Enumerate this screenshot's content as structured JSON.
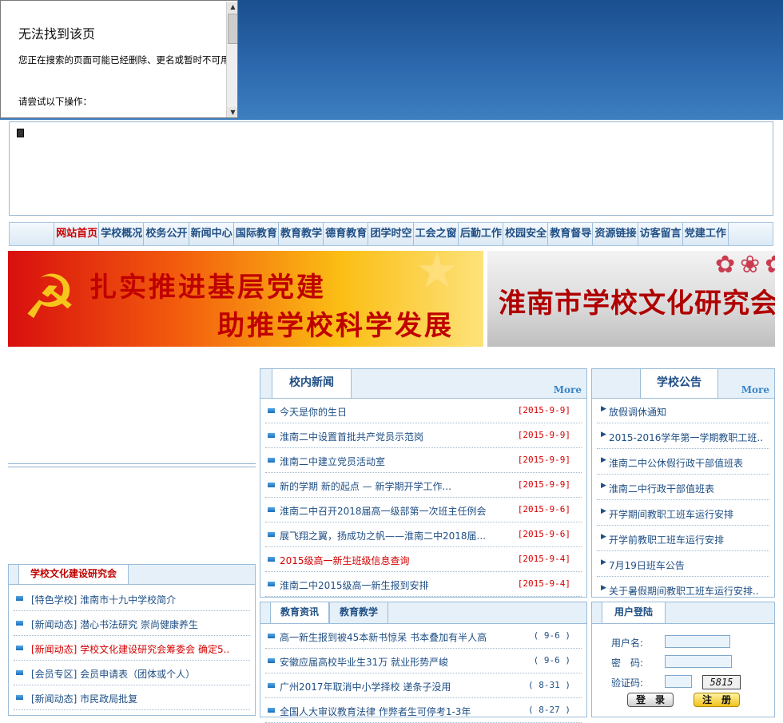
{
  "error_frame": {
    "title": "无法找到该页",
    "message": "您正在搜索的页面可能已经删除、更名或暂时不可用。",
    "try_label": "请尝试以下操作："
  },
  "nav": {
    "items": [
      "网站首页",
      "学校概况",
      "校务公开",
      "新闻中心",
      "国际教育",
      "教育教学",
      "德育教育",
      "团学时空",
      "工会之窗",
      "后勤工作",
      "校园安全",
      "教育督导",
      "资源链接",
      "访客留言",
      "党建工作"
    ],
    "active_index": 0
  },
  "banners": {
    "left_line1": "扎实推进基层党建",
    "left_line2": "助推学校科学发展",
    "right_text": "淮南市学校文化研究会"
  },
  "culture_panel": {
    "title": "学校文化建设研究会",
    "items": [
      {
        "text": "[特色学校] 淮南市十九中学校简介",
        "red": false
      },
      {
        "text": "[新闻动态] 潜心书法研究 崇尚健康养生",
        "red": false
      },
      {
        "text": "[新闻动态] 学校文化建设研究会筹委会 确定5..",
        "red": true
      },
      {
        "text": "[会员专区] 会员申请表（团体或个人）",
        "red": false
      },
      {
        "text": "[新闻动态] 市民政局批复",
        "red": false
      }
    ]
  },
  "news_panel": {
    "title": "校内新闻",
    "more": "More",
    "items": [
      {
        "text": "今天是你的生日",
        "date": "[2015-9-9]",
        "red": false
      },
      {
        "text": "淮南二中设置首批共产党员示范岗",
        "date": "[2015-9-9]",
        "red": false
      },
      {
        "text": "淮南二中建立党员活动室",
        "date": "[2015-9-9]",
        "red": false
      },
      {
        "text": "新的学期 新的起点 — 新学期开学工作...",
        "date": "[2015-9-9]",
        "red": false
      },
      {
        "text": "淮南二中召开2018届高一级部第一次班主任例会",
        "date": "[2015-9-6]",
        "red": false
      },
      {
        "text": "展飞翔之翼，扬成功之帆——淮南二中2018届...",
        "date": "[2015-9-6]",
        "red": false
      },
      {
        "text": "2015级高一新生班级信息查询",
        "date": "[2015-9-4]",
        "red": true
      },
      {
        "text": "淮南二中2015级高一新生报到安排",
        "date": "[2015-9-4]",
        "red": false
      }
    ]
  },
  "notice_panel": {
    "title": "学校公告",
    "more": "More",
    "items": [
      "放假调休通知",
      "2015-2016学年第一学期教职工班..",
      "淮南二中公休假行政干部值班表",
      "淮南二中行政干部值班表",
      "开学期间教职工班车运行安排",
      "开学前教职工班车运行安排",
      "7月19日班车公告",
      "关于暑假期间教职工班车运行安排.."
    ]
  },
  "edu_panel": {
    "tabs": [
      "教育资讯",
      "教育教学"
    ],
    "items": [
      {
        "text": "高一新生报到被45本新书惊呆 书本叠加有半人高",
        "date": "( 9-6 )"
      },
      {
        "text": "安徽应届高校毕业生31万 就业形势严峻",
        "date": "( 9-6 )"
      },
      {
        "text": "广州2017年取消中小学择校 递条子没用",
        "date": "( 8-31 )"
      },
      {
        "text": "全国人大审议教育法律 作弊者生可停考1-3年",
        "date": "( 8-27 )"
      }
    ]
  },
  "login_panel": {
    "title": "用户登陆",
    "username_label": "用户名:",
    "password_label": "密　码:",
    "captcha_label": "验证码:",
    "captcha_value": "5815",
    "login_button": "登　录",
    "register_button": "注　册"
  }
}
